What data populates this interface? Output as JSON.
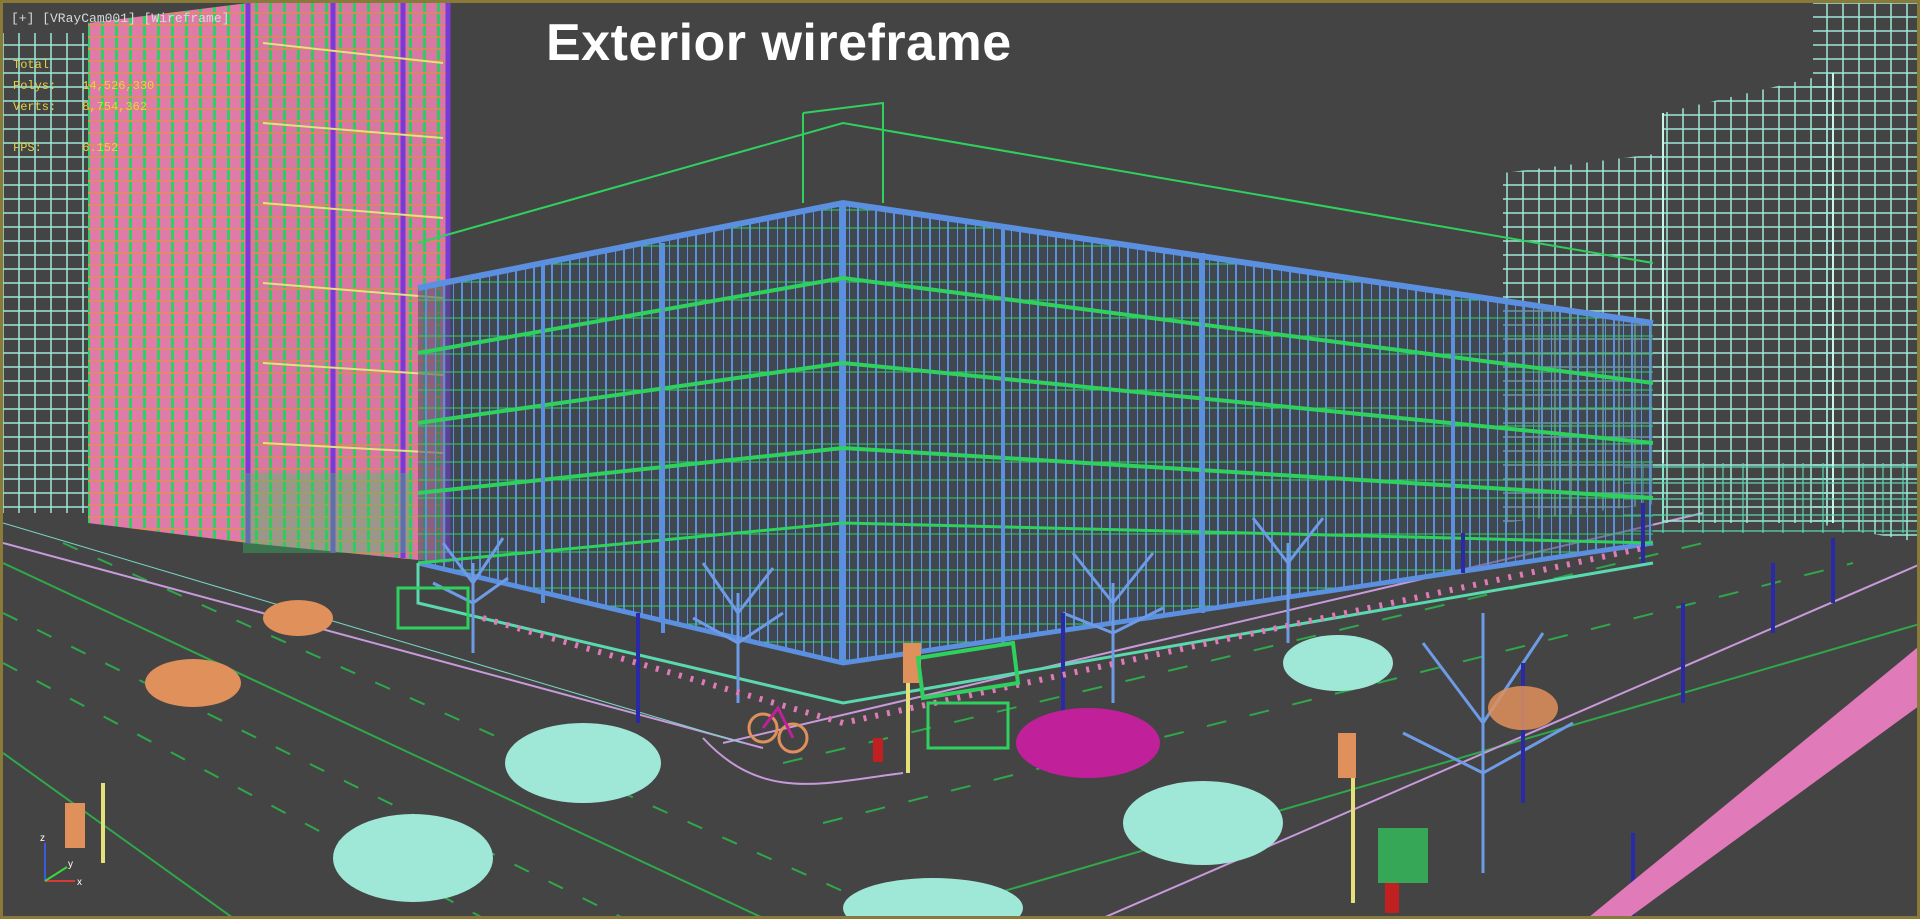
{
  "viewport": {
    "label": "[+] [VRayCam001] [Wireframe]",
    "title": "Exterior wireframe"
  },
  "stats": {
    "header": "Total",
    "rows": [
      {
        "key": "Polys:",
        "value": "14,526,330"
      },
      {
        "key": "Verts:",
        "value": "8,754,362"
      },
      {
        "key": "FPS:",
        "value": "6.152"
      }
    ]
  },
  "axis": {
    "x": "x",
    "y": "y",
    "z": "z"
  },
  "colors": {
    "background": "#444444",
    "frame": "#8a7a3a",
    "garage": "#5b8fe0",
    "garage_slabs": "#2fd15e",
    "tower_left": "#e07aa8",
    "tower_left_frame": "#7a3ad8",
    "buildings_right": "#9fe8d8",
    "cars": "#9fe8d8",
    "car_accent": "#c0209a",
    "car_orange": "#e0905a",
    "road_lines": "#3fbf3f",
    "trees": "#6e9be6",
    "poles": "#2a2aa8",
    "fence": "#e07ab8"
  }
}
